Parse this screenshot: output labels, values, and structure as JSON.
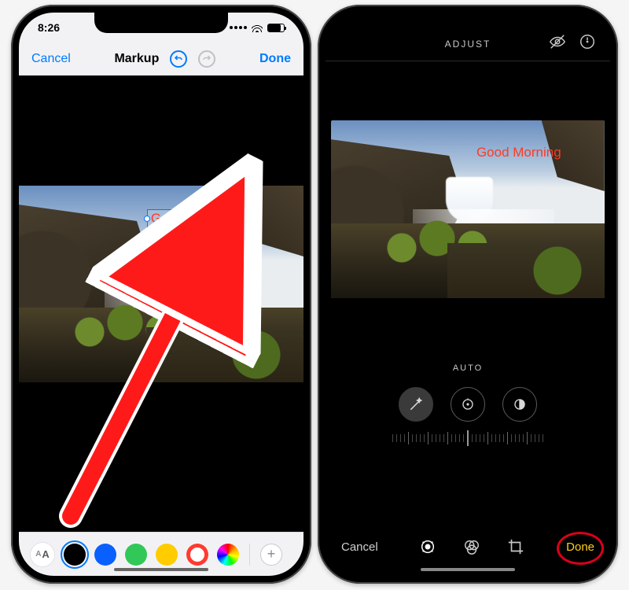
{
  "left": {
    "status": {
      "time": "8:26"
    },
    "nav": {
      "cancel": "Cancel",
      "title": "Markup",
      "done": "Done"
    },
    "annotation_text": "Good Morning",
    "palette": {
      "aa_small": "A",
      "aa_big": "A",
      "colors": [
        "#000000",
        "#0a60ff",
        "#32c759",
        "#ffcc00",
        "#ff3b30"
      ],
      "selected_index": 0
    },
    "icons": {
      "undo": "undo-icon",
      "redo": "redo-icon",
      "plus": "+"
    }
  },
  "right": {
    "top": {
      "title": "ADJUST"
    },
    "annotation_text": "Good Morning",
    "auto_label": "AUTO",
    "bottom": {
      "cancel": "Cancel",
      "done": "Done"
    }
  }
}
